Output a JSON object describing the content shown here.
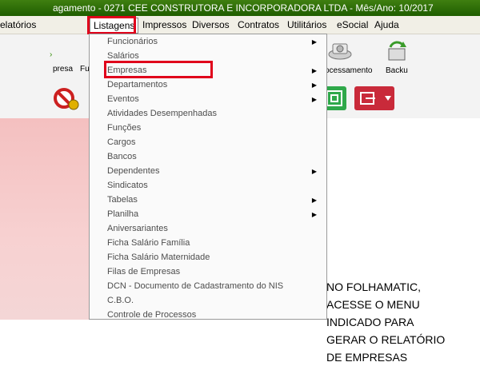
{
  "title": "agamento - 0271 CEE CONSTRUTORA E INCORPORADORA LTDA - Mês/Ano: 10/2017",
  "menu": {
    "items": [
      "elatórios",
      "Listagens",
      "Impressos",
      "Diversos",
      "Contratos",
      "Utilitários",
      "eSocial",
      "Ajuda"
    ]
  },
  "toolbar": {
    "left_label": "presa",
    "mid_label": "Fu",
    "proc_label": "ocessamento",
    "backup_label": "Backu"
  },
  "dropdown": {
    "items": [
      {
        "label": "Funcionários",
        "submenu": true
      },
      {
        "label": "Salários",
        "submenu": false
      },
      {
        "label": "Empresas",
        "submenu": true
      },
      {
        "label": "Departamentos",
        "submenu": true
      },
      {
        "label": "Eventos",
        "submenu": true
      },
      {
        "label": "Atividades Desempenhadas",
        "submenu": false
      },
      {
        "label": "Funções",
        "submenu": false
      },
      {
        "label": "Cargos",
        "submenu": false
      },
      {
        "label": "Bancos",
        "submenu": false
      },
      {
        "label": "Dependentes",
        "submenu": true
      },
      {
        "label": "Sindicatos",
        "submenu": false
      },
      {
        "label": "Tabelas",
        "submenu": true
      },
      {
        "label": "Planilha",
        "submenu": true
      },
      {
        "label": "Aniversariantes",
        "submenu": false
      },
      {
        "label": "Ficha Salário Família",
        "submenu": false
      },
      {
        "label": "Ficha Salário Maternidade",
        "submenu": false
      },
      {
        "label": "Filas de Empresas",
        "submenu": false
      },
      {
        "label": "DCN - Documento de Cadastramento do NIS",
        "submenu": false
      },
      {
        "label": "C.B.O.",
        "submenu": false
      },
      {
        "label": "Controle de Processos",
        "submenu": false
      }
    ]
  },
  "annotation": {
    "lines": [
      "NO FOLHAMATIC,",
      "ACESSE O MENU",
      "INDICADO PARA",
      "GERAR O RELATÓRIO",
      "DE EMPRESAS"
    ]
  },
  "colors": {
    "highlight": "#e0001b",
    "titlebar": "#2e6e08",
    "pink_bg": "#f6cccc"
  }
}
